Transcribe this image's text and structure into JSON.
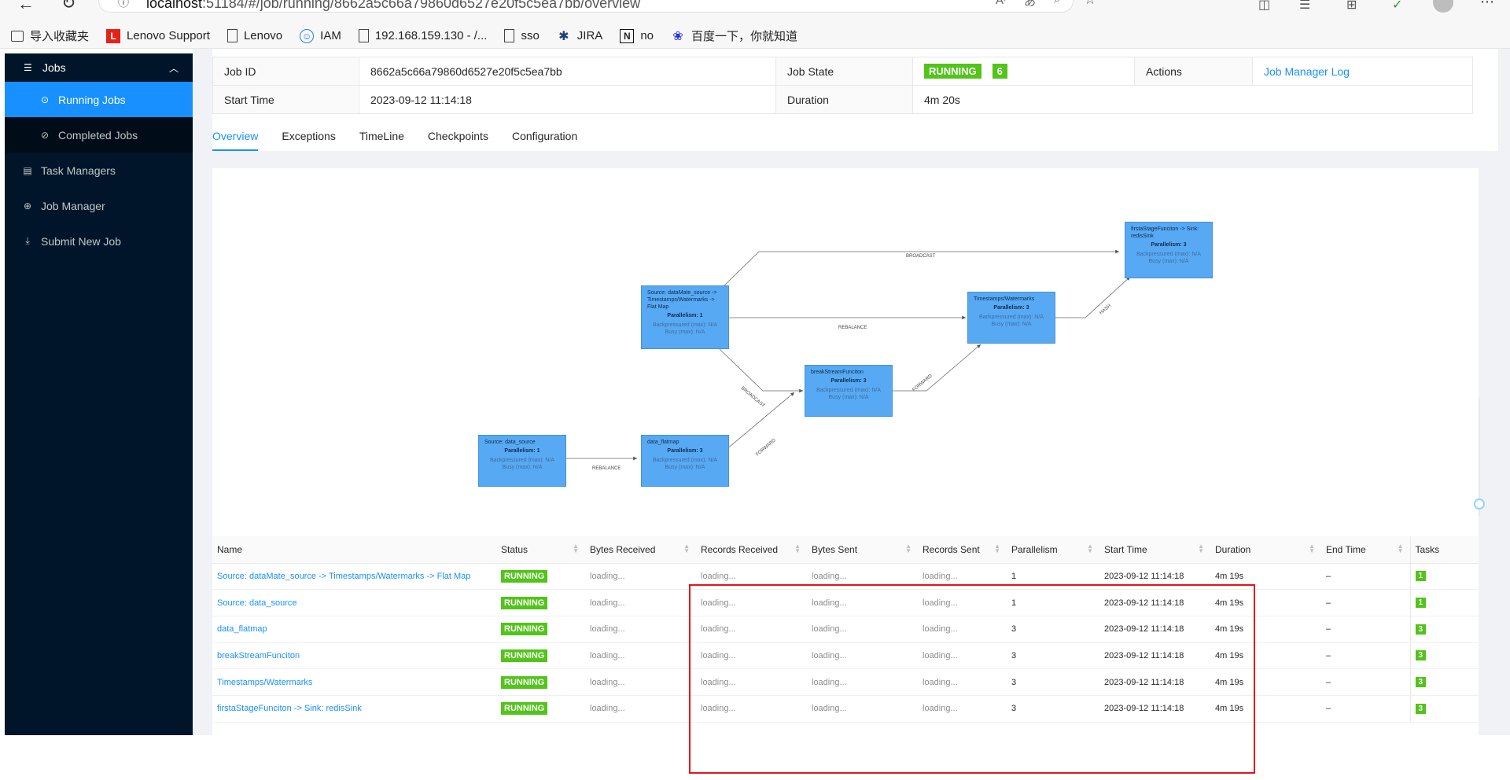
{
  "browser": {
    "url_prefix": "localhost",
    "url_rest": ":51184/#/job/running/8662a5c66a79860d6527e20f5c5ea7bb/overview"
  },
  "bookmarks": [
    {
      "icon": "import-favorites-icon",
      "label": "导入收藏夹"
    },
    {
      "icon": "lenovo-l-icon",
      "label": "Lenovo Support"
    },
    {
      "icon": "page-icon",
      "label": "Lenovo"
    },
    {
      "icon": "iam-icon",
      "label": "IAM"
    },
    {
      "icon": "page-icon",
      "label": "192.168.159.130 - /..."
    },
    {
      "icon": "page-icon",
      "label": "sso"
    },
    {
      "icon": "jira-icon",
      "label": "JIRA"
    },
    {
      "icon": "notion-icon",
      "label": "no"
    },
    {
      "icon": "baidu-paw-icon",
      "label": "百度一下，你就知道"
    }
  ],
  "sidebar": {
    "jobs": "Jobs",
    "running": "Running Jobs",
    "completed": "Completed Jobs",
    "task_managers": "Task Managers",
    "job_manager": "Job Manager",
    "submit": "Submit New Job"
  },
  "summary": {
    "job_id_label": "Job ID",
    "job_id": "8662a5c66a79860d6527e20f5c5ea7bb",
    "job_state_label": "Job State",
    "job_state": "RUNNING",
    "job_state_count": "6",
    "actions_label": "Actions",
    "actions_link": "Job Manager Log",
    "start_time_label": "Start Time",
    "start_time": "2023-09-12 11:14:18",
    "duration_label": "Duration",
    "duration": "4m 20s"
  },
  "tabs": [
    "Overview",
    "Exceptions",
    "TimeLine",
    "Checkpoints",
    "Configuration"
  ],
  "graph": {
    "nodes": {
      "source_data": {
        "name": "Source: data_source",
        "parallelism": "Parallelism: 1"
      },
      "flatmap": {
        "name": "data_flatmap",
        "parallelism": "Parallelism: 3"
      },
      "source_datamate": {
        "name": "Source: dataMate_source -> Timestamps/Watermarks -> Flat Map",
        "parallelism": "Parallelism: 1"
      },
      "break": {
        "name": "breakStreamFunciton",
        "parallelism": "Parallelism: 3"
      },
      "timestamps": {
        "name": "Timestamps/Watermarks",
        "parallelism": "Parallelism: 3"
      },
      "sink": {
        "name": "firstaStageFunciton -> Sink: redisSink",
        "parallelism": "Parallelism: 3"
      }
    },
    "metric_backpressured": "Backpressured (max): N/A",
    "metric_busy": "Busy (max): N/A",
    "edges": {
      "e1": "REBALANCE",
      "e2": "FORWARD",
      "e3": "BROADCAST",
      "e4": "REBALANCE",
      "e5": "BROADCAST",
      "e6": "FORWARD",
      "e7": "HASH"
    }
  },
  "table": {
    "headers": [
      "Name",
      "Status",
      "Bytes Received",
      "Records Received",
      "Bytes Sent",
      "Records Sent",
      "Parallelism",
      "Start Time",
      "Duration",
      "End Time",
      "Tasks"
    ],
    "rows": [
      {
        "name": "Source: dataMate_source -> Timestamps/Watermarks -> Flat Map",
        "status": "RUNNING",
        "bytes_in": "loading...",
        "rec_in": "loading...",
        "bytes_out": "loading...",
        "rec_out": "loading...",
        "par": "1",
        "start": "2023-09-12 11:14:18",
        "dur": "4m 19s",
        "end": "–",
        "tasks": "1"
      },
      {
        "name": "Source: data_source",
        "status": "RUNNING",
        "bytes_in": "loading...",
        "rec_in": "loading...",
        "bytes_out": "loading...",
        "rec_out": "loading...",
        "par": "1",
        "start": "2023-09-12 11:14:18",
        "dur": "4m 19s",
        "end": "–",
        "tasks": "1"
      },
      {
        "name": "data_flatmap",
        "status": "RUNNING",
        "bytes_in": "loading...",
        "rec_in": "loading...",
        "bytes_out": "loading...",
        "rec_out": "loading...",
        "par": "3",
        "start": "2023-09-12 11:14:18",
        "dur": "4m 19s",
        "end": "–",
        "tasks": "3"
      },
      {
        "name": "breakStreamFunciton",
        "status": "RUNNING",
        "bytes_in": "loading...",
        "rec_in": "loading...",
        "bytes_out": "loading...",
        "rec_out": "loading...",
        "par": "3",
        "start": "2023-09-12 11:14:18",
        "dur": "4m 19s",
        "end": "–",
        "tasks": "3"
      },
      {
        "name": "Timestamps/Watermarks",
        "status": "RUNNING",
        "bytes_in": "loading...",
        "rec_in": "loading...",
        "bytes_out": "loading...",
        "rec_out": "loading...",
        "par": "3",
        "start": "2023-09-12 11:14:18",
        "dur": "4m 19s",
        "end": "–",
        "tasks": "3"
      },
      {
        "name": "firstaStageFunciton -> Sink: redisSink",
        "status": "RUNNING",
        "bytes_in": "loading...",
        "rec_in": "loading...",
        "bytes_out": "loading...",
        "rec_out": "loading...",
        "par": "3",
        "start": "2023-09-12 11:14:18",
        "dur": "4m 19s",
        "end": "–",
        "tasks": "3"
      }
    ]
  },
  "colors": {
    "accent": "#1890ff",
    "running": "#52c41a",
    "sidebar": "#001529",
    "highlight": "#e8111a"
  }
}
